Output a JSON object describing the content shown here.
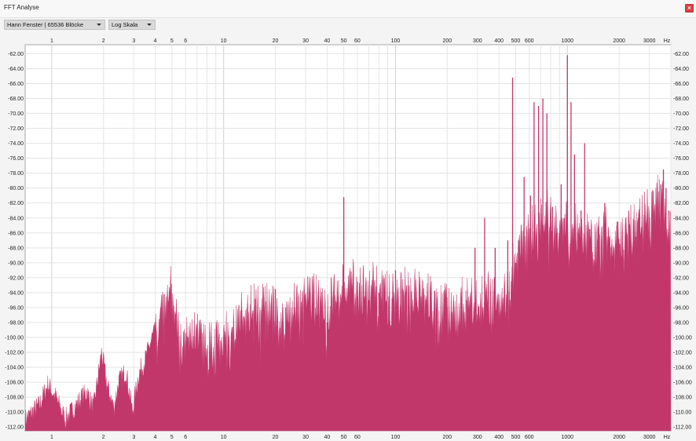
{
  "window": {
    "title": "FFT Analyse",
    "close_icon": "close-icon",
    "close_color": "#d23d3d"
  },
  "toolbar": {
    "window_select": "Hann Fenster | 65536 Blöcke",
    "scale_select": "Log Skala"
  },
  "chart_data": {
    "type": "area",
    "x_scale": "log",
    "x_unit": "Hz",
    "xlim": [
      0.7,
      4000
    ],
    "ylim": [
      -112.5,
      -60.8
    ],
    "x_ticks_labeled": [
      "1",
      "2",
      "3",
      "4",
      "5",
      "6",
      "10",
      "20",
      "30",
      "40",
      "50",
      "60",
      "100",
      "200",
      "300",
      "400",
      "500",
      "600",
      "1000",
      "2000",
      "3000"
    ],
    "y_ticks": [
      "-62.00",
      "-64.00",
      "-66.00",
      "-68.00",
      "-70.00",
      "-72.00",
      "-74.00",
      "-76.00",
      "-78.00",
      "-80.00",
      "-82.00",
      "-84.00",
      "-86.00",
      "-88.00",
      "-90.00",
      "-92.00",
      "-94.00",
      "-96.00",
      "-98.00",
      "-100.00",
      "-102.00",
      "-104.00",
      "-106.00",
      "-108.00",
      "-110.00",
      "-112.00"
    ],
    "grid": true,
    "fill_color": "#c2376a",
    "envelope": [
      [
        0.7,
        -112.5
      ],
      [
        0.85,
        -110.5
      ],
      [
        0.95,
        -107.8
      ],
      [
        1.05,
        -109.5
      ],
      [
        1.2,
        -112.5
      ],
      [
        1.45,
        -110
      ],
      [
        1.6,
        -108.8
      ],
      [
        1.75,
        -111
      ],
      [
        1.95,
        -103.5
      ],
      [
        2.1,
        -108
      ],
      [
        2.3,
        -111
      ],
      [
        2.45,
        -107.5
      ],
      [
        2.7,
        -106
      ],
      [
        2.95,
        -111.5
      ],
      [
        3.2,
        -106.5
      ],
      [
        3.5,
        -104.5
      ],
      [
        3.9,
        -101
      ],
      [
        4.4,
        -100.5
      ],
      [
        4.9,
        -96.8
      ],
      [
        5.4,
        -100.5
      ],
      [
        6,
        -103
      ],
      [
        7,
        -102
      ],
      [
        8,
        -104
      ],
      [
        10,
        -103
      ],
      [
        12,
        -100
      ],
      [
        15,
        -99.5
      ],
      [
        18,
        -99
      ],
      [
        22,
        -100
      ],
      [
        26,
        -99
      ],
      [
        30,
        -98
      ],
      [
        35,
        -97
      ],
      [
        40,
        -99.5
      ],
      [
        45,
        -96.5
      ],
      [
        55,
        -96
      ],
      [
        70,
        -96.5
      ],
      [
        90,
        -97.5
      ],
      [
        110,
        -96.5
      ],
      [
        130,
        -97
      ],
      [
        160,
        -98
      ],
      [
        200,
        -98.5
      ],
      [
        250,
        -98.5
      ],
      [
        300,
        -97.5
      ],
      [
        350,
        -97.5
      ],
      [
        420,
        -97
      ],
      [
        470,
        -95
      ],
      [
        520,
        -90.5
      ],
      [
        620,
        -88.5
      ],
      [
        750,
        -86.5
      ],
      [
        900,
        -88
      ],
      [
        1100,
        -87.5
      ],
      [
        1400,
        -90
      ],
      [
        1700,
        -89
      ],
      [
        2100,
        -89.5
      ],
      [
        2600,
        -87.5
      ],
      [
        3100,
        -85
      ],
      [
        3600,
        -84.5
      ],
      [
        4000,
        -88
      ]
    ],
    "peaks": [
      [
        1.95,
        -103.5
      ],
      [
        4.9,
        -96.8
      ],
      [
        5.2,
        -99
      ],
      [
        10,
        -100
      ],
      [
        12,
        -101
      ],
      [
        20,
        -93.5
      ],
      [
        23,
        -96
      ],
      [
        30,
        -98
      ],
      [
        35,
        -97
      ],
      [
        40,
        -98
      ],
      [
        45,
        -95.5
      ],
      [
        50,
        -81.2
      ],
      [
        55,
        -94
      ],
      [
        60,
        -94.5
      ],
      [
        70,
        -95
      ],
      [
        80,
        -94
      ],
      [
        100,
        -91
      ],
      [
        110,
        -93.5
      ],
      [
        150,
        -95
      ],
      [
        200,
        -96
      ],
      [
        260,
        -95
      ],
      [
        290,
        -88
      ],
      [
        330,
        -84
      ],
      [
        380,
        -88
      ],
      [
        450,
        -87
      ],
      [
        480,
        -65.2
      ],
      [
        500,
        -90
      ],
      [
        520,
        -87
      ],
      [
        560,
        -78.5
      ],
      [
        610,
        -81
      ],
      [
        640,
        -68.5
      ],
      [
        680,
        -69
      ],
      [
        720,
        -68
      ],
      [
        760,
        -70
      ],
      [
        820,
        -82.5
      ],
      [
        870,
        -86
      ],
      [
        920,
        -79.5
      ],
      [
        960,
        -84
      ],
      [
        1000,
        -62.2
      ],
      [
        1050,
        -68.5
      ],
      [
        1100,
        -75.5
      ],
      [
        1150,
        -86
      ],
      [
        1200,
        -83
      ],
      [
        1260,
        -74
      ],
      [
        1350,
        -85.5
      ],
      [
        1500,
        -87
      ],
      [
        1650,
        -82
      ],
      [
        1800,
        -89
      ],
      [
        1950,
        -84.5
      ],
      [
        2100,
        -88
      ],
      [
        2300,
        -85
      ],
      [
        2500,
        -86.5
      ],
      [
        2800,
        -86
      ],
      [
        3000,
        -84
      ],
      [
        3300,
        -83.5
      ],
      [
        3500,
        -79.5
      ],
      [
        3620,
        -77.5
      ],
      [
        3750,
        -80
      ],
      [
        3900,
        -83
      ]
    ]
  }
}
